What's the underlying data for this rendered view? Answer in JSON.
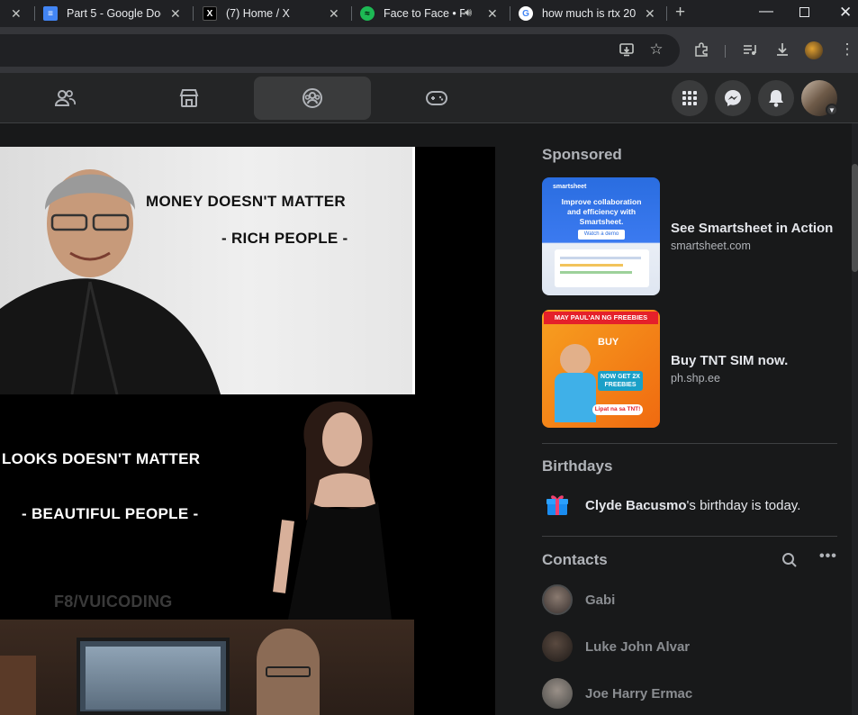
{
  "tabs": [
    {
      "title": "Part 5 - Google Doc",
      "favicon": "docs-icon",
      "active": false
    },
    {
      "title": "(7) Home / X",
      "favicon": "x-icon",
      "active": false
    },
    {
      "title": "Face to Face • R",
      "favicon": "spotify-icon",
      "active": false,
      "audio": true
    },
    {
      "title": "how much is rtx 20",
      "favicon": "google-icon",
      "active": false
    }
  ],
  "toolbar": {
    "new_tab": "+"
  },
  "meme": {
    "line1": "MONEY DOESN'T MATTER",
    "line2": "- RICH PEOPLE -",
    "line3": "LOOKS DOESN'T MATTER",
    "line4": "- BEAUTIFUL PEOPLE -",
    "watermark": "F8/VUICODING"
  },
  "sidebar": {
    "sponsored_title": "Sponsored",
    "ads": [
      {
        "title": "See Smartsheet in Action",
        "domain": "smartsheet.com",
        "thumb_brand": "smartsheet",
        "thumb_text": "Improve collaboration and efficiency with Smartsheet.",
        "thumb_cta": "Watch a demo"
      },
      {
        "title": "Buy TNT SIM now.",
        "domain": "ph.shp.ee",
        "thumb_banner": "MAY PAUL'AN NG FREEBIES",
        "thumb_buy": "BUY",
        "thumb_get": "NOW GET 2X FREEBIES",
        "thumb_cta": "Lipat na sa TNT!"
      }
    ],
    "birthdays_title": "Birthdays",
    "birthday_name": "Clyde Bacusmo",
    "birthday_suffix": "'s birthday is today.",
    "contacts_title": "Contacts",
    "contacts": [
      {
        "name": "Gabi"
      },
      {
        "name": "Luke John Alvar"
      },
      {
        "name": "Joe Harry Ermac"
      }
    ]
  },
  "colors": {
    "accent": "#1877f2",
    "bg": "#18191a",
    "surface": "#242526"
  }
}
